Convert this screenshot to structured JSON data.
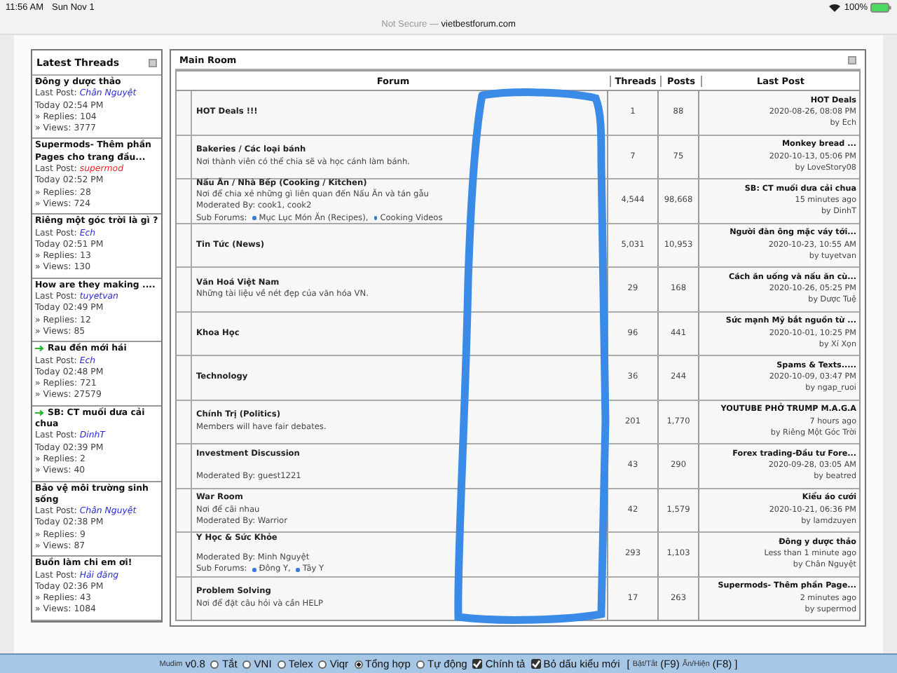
{
  "status_bar": {
    "time": "11:56 AM",
    "date": "Sun Nov 1",
    "security": "Not Secure —",
    "domain": "vietbestforum.com",
    "battery": "100%"
  },
  "latest_threads": {
    "title": "Latest Threads",
    "items": [
      {
        "title": "Đông y dược thảo",
        "new": false,
        "last_post_label": "Last Post:",
        "user": {
          "name": "Chân Nguyệt",
          "color": "#2b2bd6"
        },
        "time": "Today 02:54 PM",
        "replies": "» Replies: 104",
        "views": "» Views: 3777"
      },
      {
        "title": "Supermods- Thêm phần Pages cho trang đầu...",
        "new": false,
        "last_post_label": "Last Post:",
        "user": {
          "name": "supermod",
          "color": "#e0282c"
        },
        "time": "Today 02:52 PM",
        "replies": "» Replies: 28",
        "views": "» Views: 724"
      },
      {
        "title": "Riêng một góc trời là gì ?",
        "new": false,
        "last_post_label": "Last Post:",
        "user": {
          "name": "Ech",
          "color": "#2b2bd6"
        },
        "time": "Today 02:51 PM",
        "replies": "» Replies: 13",
        "views": "» Views: 130"
      },
      {
        "title": "How are they making ....",
        "new": false,
        "last_post_label": "Last Post:",
        "user": {
          "name": "tuyetvan",
          "color": "#2b2bd6"
        },
        "time": "Today 02:49 PM",
        "replies": "» Replies: 12",
        "views": "» Views: 85"
      },
      {
        "title": "Rau đền mới hái",
        "new": true,
        "last_post_label": "Last Post:",
        "user": {
          "name": "Ech",
          "color": "#2b2bd6"
        },
        "time": "Today 02:48 PM",
        "replies": "» Replies: 721",
        "views": "» Views: 27579"
      },
      {
        "title": "SB: CT muối dưa cải chua",
        "new": true,
        "last_post_label": "Last Post:",
        "user": {
          "name": "DinhT",
          "color": "#2b2bd6"
        },
        "time": "Today 02:39 PM",
        "replies": "» Replies: 2",
        "views": "» Views: 40"
      },
      {
        "title": "Bảo vệ môi trường sinh sống",
        "new": false,
        "last_post_label": "Last Post:",
        "user": {
          "name": "Chân Nguyệt",
          "color": "#2b2bd6"
        },
        "time": "Today 02:38 PM",
        "replies": "» Replies: 9",
        "views": "» Views: 87"
      },
      {
        "title": "Buồn làm chi em ơi!",
        "new": false,
        "last_post_label": "Last Post:",
        "user": {
          "name": "Hải đăng",
          "color": "#2b2bd6"
        },
        "time": "Today 02:36 PM",
        "replies": "» Replies: 43",
        "views": "» Views: 1084"
      }
    ]
  },
  "main_room": {
    "title": "Main Room",
    "columns": [
      "Forum",
      "Threads",
      "Posts",
      "Last Post"
    ],
    "rows": [
      {
        "name": "HOT Deals !!!",
        "threads": "1",
        "posts": "88",
        "last_post": {
          "title": "HOT Deals",
          "time": "2020-08-26, 08:08 PM",
          "by": "by Ech"
        }
      },
      {
        "name": "Bakeries / Các loại bánh",
        "description": "Nơi thành viên có thể chia sẽ và học cánh làm bánh.",
        "threads": "7",
        "posts": "75",
        "last_post": {
          "title": "Monkey bread ...",
          "time": "2020-10-13, 05:06 PM",
          "by": "by LoveStory08"
        }
      },
      {
        "name": "Nấu Ăn / Nhà Bếp (Cooking / Kitchen)",
        "description": "Nơi để chia xẻ những gì liên quan đến Nấu Ăn và tán gẫu",
        "moderated_by": "Moderated By: cook1, cook2",
        "sub_forums_label": "Sub Forums:",
        "sub_forums": [
          "Mục Lục Món Ăn (Recipes),",
          "Cooking Videos"
        ],
        "threads": "4,544",
        "posts": "98,668",
        "last_post": {
          "title": "SB: CT muối dưa cải chua",
          "time": "15 minutes ago",
          "by": "by DinhT"
        }
      },
      {
        "name": "Tin Tức (News)",
        "threads": "5,031",
        "posts": "10,953",
        "last_post": {
          "title": "Người đàn ông mặc váy tới...",
          "time": "2020-10-23, 10:55 AM",
          "by": "by tuyetvan"
        }
      },
      {
        "name": "Văn Hoá Việt Nam",
        "description": "Những tài liệu về nét đẹp của văn hóa VN.",
        "threads": "29",
        "posts": "168",
        "last_post": {
          "title": "Cách ăn uống và nấu ăn cù...",
          "time": "2020-10-26, 05:25 PM",
          "by": "by Dược Tuệ"
        }
      },
      {
        "name": "Khoa Học",
        "threads": "96",
        "posts": "441",
        "last_post": {
          "title": "Sức mạnh Mỹ bắt nguồn từ ...",
          "time": "2020-10-01, 10:25 PM",
          "by": "by Xí Xọn"
        }
      },
      {
        "name": "Technology",
        "threads": "36",
        "posts": "244",
        "last_post": {
          "title": "Spams & Texts.....",
          "time": "2020-10-09, 03:47 PM",
          "by": "by ngap_ruoi"
        }
      },
      {
        "name": "Chính Trị (Politics)",
        "description": "Members will have fair debates.",
        "threads": "201",
        "posts": "1,770",
        "last_post": {
          "title": "YOUTUBE PHỞ TRUMP M.A.G.A",
          "time": "7 hours ago",
          "by": "by Riêng Một Góc Trời"
        }
      },
      {
        "name": "Investment Discussion",
        "moderated_by": "Moderated By: guest1221",
        "threads": "43",
        "posts": "290",
        "last_post": {
          "title": "Forex trading-Đầu tư Fore...",
          "time": "2020-09-28, 03:05 AM",
          "by": "by beatred"
        }
      },
      {
        "name": "War Room",
        "description": "Nơi để cãi nhau",
        "moderated_by": "Moderated By: Warrior",
        "threads": "42",
        "posts": "1,579",
        "last_post": {
          "title": "Kiểu áo cưới",
          "time": "2020-10-21, 06:36 PM",
          "by": "by lamdzuyen"
        }
      },
      {
        "name": "Y Học & Sức Khỏe",
        "moderated_by": "Moderated By: Minh Nguyệt",
        "sub_forums_label": "Sub Forums:",
        "sub_forums": [
          "Đông Y,",
          "Tây Y"
        ],
        "threads": "293",
        "posts": "1,103",
        "last_post": {
          "title": "Đông y dược thảo",
          "time": "Less than 1 minute ago",
          "by": "by Chân Nguyệt"
        }
      },
      {
        "name": "Problem Solving",
        "description": "Nơi để đặt câu hỏi và cần HELP",
        "threads": "17",
        "posts": "263",
        "last_post": {
          "title": "Supermods- Thêm phần Page...",
          "time": "2 minutes ago",
          "by": "by supermod"
        }
      }
    ]
  },
  "mudim_bar": {
    "brand": "Mudim",
    "version": "v0.8",
    "options": [
      {
        "kind": "radio",
        "label": "Tắt",
        "selected": false
      },
      {
        "kind": "radio",
        "label": "VNI",
        "selected": false
      },
      {
        "kind": "radio",
        "label": "Telex",
        "selected": false
      },
      {
        "kind": "radio",
        "label": "Viqr",
        "selected": false
      },
      {
        "kind": "radio",
        "label": "Tổng hợp",
        "selected": true
      },
      {
        "kind": "radio",
        "label": "Tự động",
        "selected": false
      },
      {
        "kind": "checkbox",
        "label": "Chính tả",
        "checked": true
      },
      {
        "kind": "checkbox",
        "label": "Bỏ dấu kiểu mới",
        "checked": true
      }
    ],
    "hint": {
      "open": "[",
      "toggle_link": "Bật/Tắt",
      "toggle_key": "(F9)",
      "show_link": "Ẩn/Hiện",
      "show_key": "(F8)",
      "close": "]"
    }
  }
}
